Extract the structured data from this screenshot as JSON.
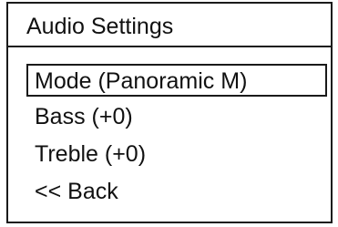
{
  "screen": {
    "title": "Audio Settings"
  },
  "menu": {
    "items": [
      {
        "label": "Mode (Panoramic M)",
        "selected": true
      },
      {
        "label": "Bass (+0)",
        "selected": false
      },
      {
        "label": "Treble (+0)",
        "selected": false
      },
      {
        "label": "<< Back",
        "selected": false
      }
    ]
  }
}
